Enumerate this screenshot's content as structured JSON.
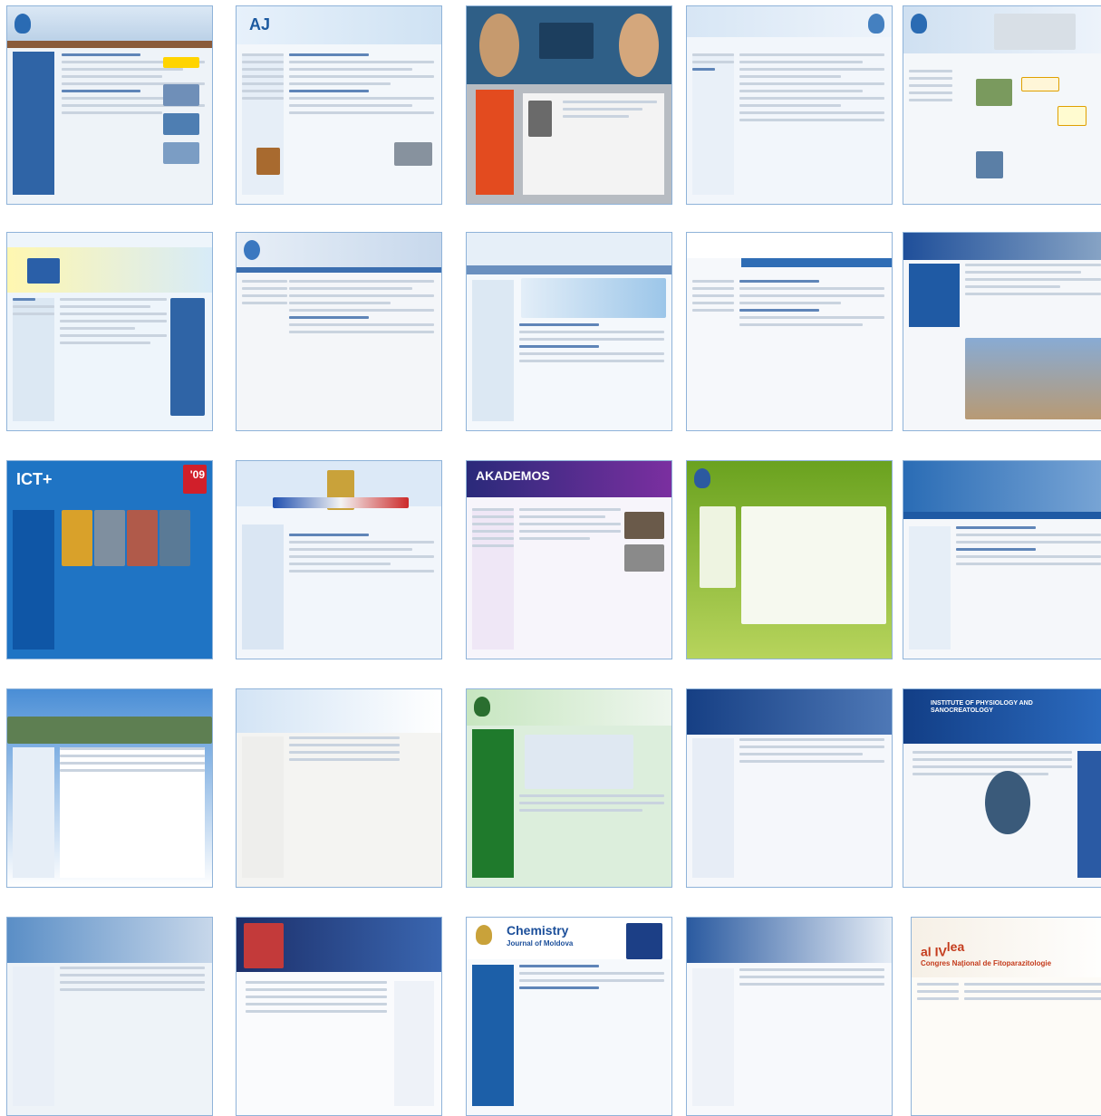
{
  "thumbnails": [
    {
      "id": 1,
      "title": ""
    },
    {
      "id": 2,
      "title": "AJ"
    },
    {
      "id": 3,
      "title": ""
    },
    {
      "id": 4,
      "title": ""
    },
    {
      "id": 5,
      "title": ""
    },
    {
      "id": 6,
      "title": ""
    },
    {
      "id": 7,
      "title": ""
    },
    {
      "id": 8,
      "title": ""
    },
    {
      "id": 9,
      "title": ""
    },
    {
      "id": 10,
      "title": ""
    },
    {
      "id": 11,
      "title": "ICT+",
      "badge": "'09"
    },
    {
      "id": 12,
      "title": ""
    },
    {
      "id": 13,
      "title": "AKADEMOS"
    },
    {
      "id": 14,
      "title": ""
    },
    {
      "id": 15,
      "title": ""
    },
    {
      "id": 16,
      "title": ""
    },
    {
      "id": 17,
      "title": ""
    },
    {
      "id": 18,
      "title": ""
    },
    {
      "id": 19,
      "title": ""
    },
    {
      "id": 20,
      "title": "INSTITUTE OF PHYSIOLOGY AND SANOCREATOLOGY"
    },
    {
      "id": 21,
      "title": ""
    },
    {
      "id": 22,
      "title": ""
    },
    {
      "id": 23,
      "title": "Chemistry",
      "subtitle": "Journal of Moldova"
    },
    {
      "id": 24,
      "title": ""
    },
    {
      "id": 25,
      "title": "al IV",
      "sup": "lea",
      "subtitle": "Congres Naţional de Fitoparazitologie"
    }
  ]
}
